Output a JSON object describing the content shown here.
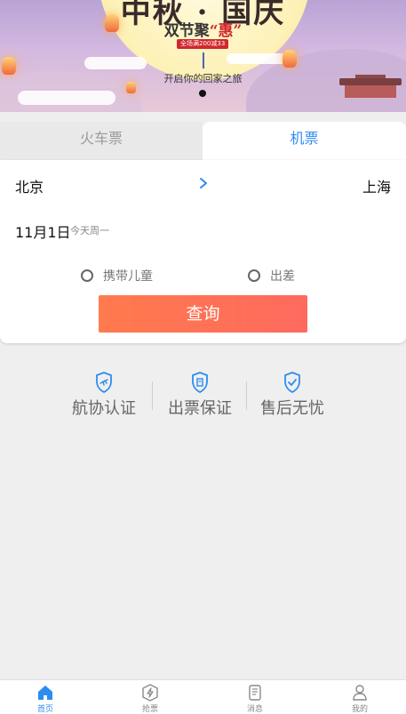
{
  "banner": {
    "title": "中秋 · 国庆",
    "subtitle_prefix": "双节聚",
    "subtitle_highlight": "“惠”",
    "badge": "全场满200减33",
    "tagline": "开启你的回家之旅"
  },
  "tabs": [
    {
      "label": "火车票",
      "active": false
    },
    {
      "label": "机票",
      "active": true
    }
  ],
  "booking": {
    "from_city": "北京",
    "to_city": "上海",
    "date": "11月1日",
    "date_hint": "今天周一",
    "options": [
      {
        "label": "携带儿童",
        "checked": false
      },
      {
        "label": "出差",
        "checked": false
      }
    ],
    "search_label": "查询"
  },
  "guarantees": [
    {
      "label": "航协认证",
      "icon": "shield-plane-icon"
    },
    {
      "label": "出票保证",
      "icon": "shield-ticket-icon"
    },
    {
      "label": "售后无忧",
      "icon": "shield-check-icon"
    }
  ],
  "bottom_nav": [
    {
      "label": "首页",
      "icon": "home-icon",
      "active": true
    },
    {
      "label": "抢票",
      "icon": "lightning-icon",
      "active": false
    },
    {
      "label": "消息",
      "icon": "message-icon",
      "active": false
    },
    {
      "label": "我的",
      "icon": "user-icon",
      "active": false
    }
  ],
  "colors": {
    "accent": "#2d8cf0",
    "search_button": "#ff6f55",
    "highlight": "#d0282d"
  }
}
